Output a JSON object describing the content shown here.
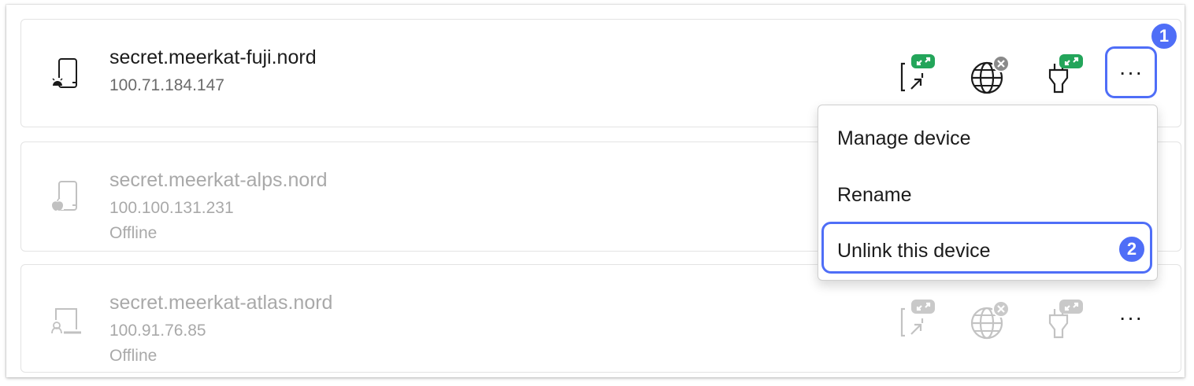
{
  "devices": [
    {
      "name": "secret.meerkat-fuji.nord",
      "ip": "100.71.184.147",
      "status": "",
      "os_icon": "android-phone-icon"
    },
    {
      "name": "secret.meerkat-alps.nord",
      "ip": "100.100.131.231",
      "status": "Offline",
      "os_icon": "apple-phone-icon"
    },
    {
      "name": "secret.meerkat-atlas.nord",
      "ip": "100.91.76.85",
      "status": "Offline",
      "os_icon": "linux-laptop-icon"
    }
  ],
  "more_button": {
    "label": "···"
  },
  "context_menu": {
    "items": [
      "Manage device",
      "Rename",
      "Unlink this device"
    ]
  },
  "step_badges": [
    "1",
    "2"
  ],
  "colors": {
    "accent": "#4f6ef7",
    "connected": "#23a55a",
    "disabled": "#8a8a8a"
  }
}
